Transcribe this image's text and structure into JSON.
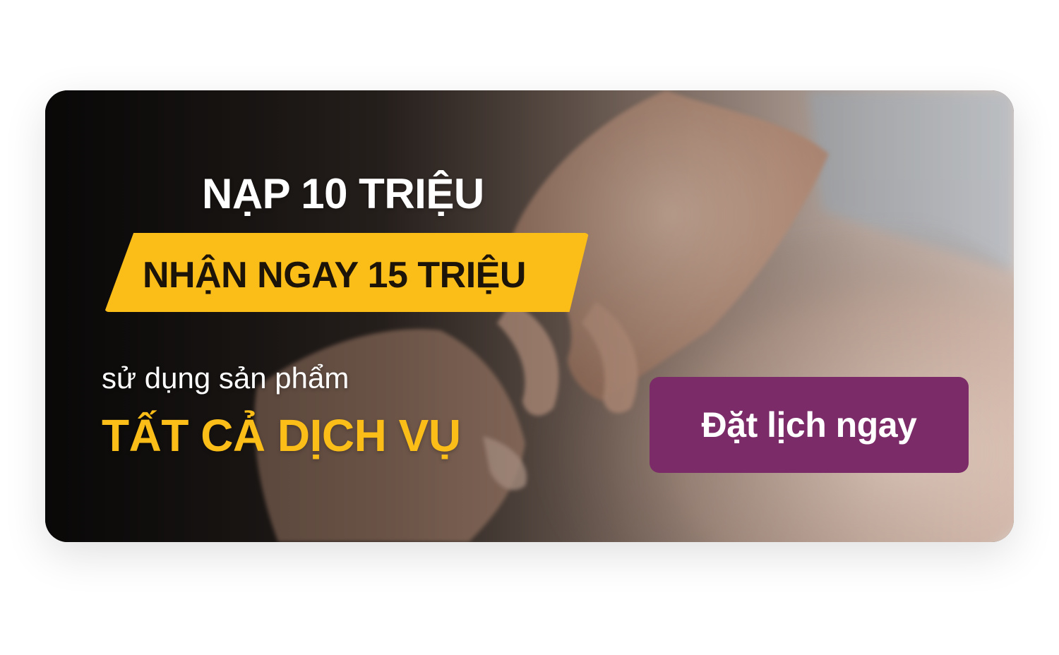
{
  "banner": {
    "headline": "NẠP 10 TRIỆU",
    "ribbon_text": "NHẬN NGAY 15 TRIỆU",
    "subtext": "sử dụng sản phẩm",
    "services_text": "TẤT CẢ DỊCH VỤ",
    "cta_label": "Đặt lịch ngay",
    "background_image": "massage-hands-photo"
  },
  "colors": {
    "accent_yellow": "#fbbd17",
    "cta_purple": "#7b2b67",
    "text_white": "#ffffff",
    "text_dark": "#1c1408"
  }
}
